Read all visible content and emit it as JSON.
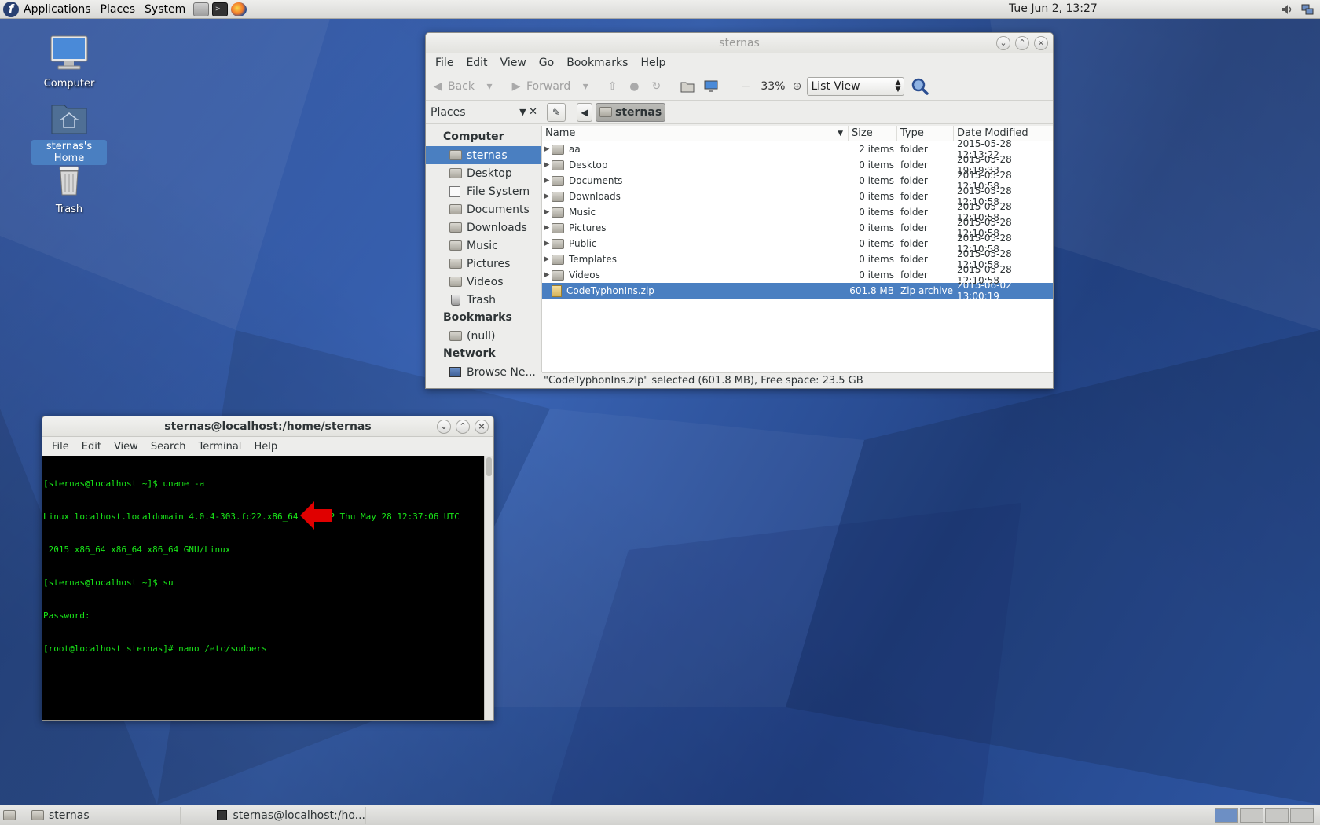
{
  "top_panel": {
    "menus": [
      "Applications",
      "Places",
      "System"
    ],
    "clock": "Tue Jun  2, 13:27",
    "launchers": [
      "files-icon",
      "terminal-icon",
      "firefox-icon"
    ],
    "tray": [
      "volume-icon",
      "network-icon"
    ]
  },
  "desktop": {
    "icons": [
      {
        "label": "Computer",
        "icon": "computer-icon"
      },
      {
        "label": "sternas's Home",
        "icon": "home-folder-icon",
        "selected": true
      },
      {
        "label": "Trash",
        "icon": "trash-icon"
      }
    ]
  },
  "file_manager": {
    "title": "sternas",
    "menu": [
      "File",
      "Edit",
      "View",
      "Go",
      "Bookmarks",
      "Help"
    ],
    "toolbar": {
      "back": "Back",
      "forward": "Forward",
      "zoom": "33%",
      "view_mode": "List View"
    },
    "places_label": "Places",
    "path_button": "sternas",
    "sidebar": {
      "sections": [
        {
          "heading": "Computer",
          "items": [
            {
              "label": "sternas",
              "icon": "home-icon",
              "selected": true
            },
            {
              "label": "Desktop",
              "icon": "folder-icon"
            },
            {
              "label": "File System",
              "icon": "filesystem-icon"
            },
            {
              "label": "Documents",
              "icon": "folder-icon"
            },
            {
              "label": "Downloads",
              "icon": "folder-icon"
            },
            {
              "label": "Music",
              "icon": "folder-icon"
            },
            {
              "label": "Pictures",
              "icon": "folder-icon"
            },
            {
              "label": "Videos",
              "icon": "folder-icon"
            },
            {
              "label": "Trash",
              "icon": "trash-icon"
            }
          ]
        },
        {
          "heading": "Bookmarks",
          "items": [
            {
              "label": "(null)",
              "icon": "folder-icon"
            }
          ]
        },
        {
          "heading": "Network",
          "items": [
            {
              "label": "Browse Ne...",
              "icon": "network-icon"
            }
          ]
        }
      ]
    },
    "columns": [
      "Name",
      "Size",
      "Type",
      "Date Modified"
    ],
    "rows": [
      {
        "name": "aa",
        "size": "2 items",
        "type": "folder",
        "date": "2015-05-28 12:13:22"
      },
      {
        "name": "Desktop",
        "size": "0 items",
        "type": "folder",
        "date": "2015-05-28 19:19:33"
      },
      {
        "name": "Documents",
        "size": "0 items",
        "type": "folder",
        "date": "2015-05-28 12:10:58"
      },
      {
        "name": "Downloads",
        "size": "0 items",
        "type": "folder",
        "date": "2015-05-28 12:10:58"
      },
      {
        "name": "Music",
        "size": "0 items",
        "type": "folder",
        "date": "2015-05-28 12:10:58"
      },
      {
        "name": "Pictures",
        "size": "0 items",
        "type": "folder",
        "date": "2015-05-28 12:10:58"
      },
      {
        "name": "Public",
        "size": "0 items",
        "type": "folder",
        "date": "2015-05-28 12:10:58"
      },
      {
        "name": "Templates",
        "size": "0 items",
        "type": "folder",
        "date": "2015-05-28 12:10:58"
      },
      {
        "name": "Videos",
        "size": "0 items",
        "type": "folder",
        "date": "2015-05-28 12:10:58"
      },
      {
        "name": "CodeTyphonIns.zip",
        "size": "601.8 MB",
        "type": "Zip archive",
        "date": "2015-06-02 13:00:19",
        "selected": true
      }
    ],
    "status": "\"CodeTyphonIns.zip\" selected (601.8 MB), Free space: 23.5 GB"
  },
  "terminal": {
    "title": "sternas@localhost:/home/sternas",
    "menu": [
      "File",
      "Edit",
      "View",
      "Search",
      "Terminal",
      "Help"
    ],
    "lines": [
      "[sternas@localhost ~]$ uname -a",
      "Linux localhost.localdomain 4.0.4-303.fc22.x86_64 #1 SMP Thu May 28 12:37:06 UTC",
      " 2015 x86_64 x86_64 x86_64 GNU/Linux",
      "[sternas@localhost ~]$ su",
      "Password:",
      "[root@localhost sternas]# nano /etc/sudoers"
    ],
    "text_color": "#19e619",
    "annotation_color": "#e00000"
  },
  "bottom_panel": {
    "tasks": [
      {
        "label": "sternas",
        "icon": "folder-icon"
      },
      {
        "label": "sternas@localhost:/ho...",
        "icon": "terminal-icon"
      }
    ],
    "workspaces": 4
  }
}
